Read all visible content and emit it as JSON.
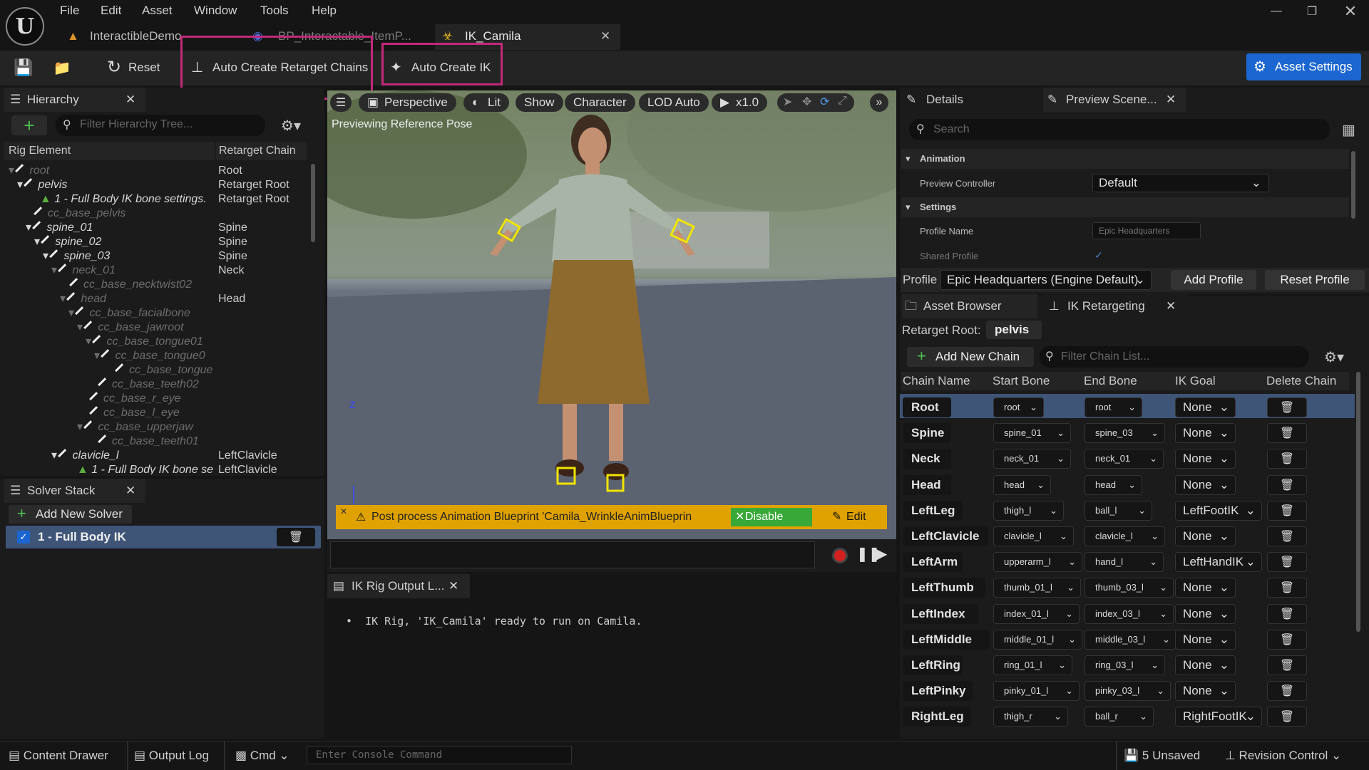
{
  "menu": [
    "File",
    "Edit",
    "Asset",
    "Window",
    "Tools",
    "Help"
  ],
  "tabs": [
    {
      "label": "InteractibleDemo"
    },
    {
      "label": "BP_Interactable_ItemP..."
    },
    {
      "label": "IK_Camila"
    }
  ],
  "toolbar": {
    "reset": "Reset",
    "auto_chains": "Auto Create Retarget Chains",
    "auto_ik": "Auto Create IK",
    "asset_settings": "Asset Settings"
  },
  "hierarchy": {
    "title": "Hierarchy",
    "filter_placeholder": "Filter Hierarchy Tree...",
    "col_element": "Rig Element",
    "col_chain": "Retarget Chain",
    "rows": [
      {
        "name": "root",
        "chain": "Root"
      },
      {
        "name": "pelvis",
        "chain": "Retarget Root"
      },
      {
        "name": "1 - Full Body IK bone settings.",
        "chain": "Retarget Root"
      },
      {
        "name": "cc_base_pelvis",
        "chain": ""
      },
      {
        "name": "spine_01",
        "chain": "Spine"
      },
      {
        "name": "spine_02",
        "chain": "Spine"
      },
      {
        "name": "spine_03",
        "chain": "Spine"
      },
      {
        "name": "neck_01",
        "chain": "Neck"
      },
      {
        "name": "cc_base_necktwist02",
        "chain": ""
      },
      {
        "name": "head",
        "chain": "Head"
      },
      {
        "name": "cc_base_facialbone",
        "chain": ""
      },
      {
        "name": "cc_base_jawroot",
        "chain": ""
      },
      {
        "name": "cc_base_tongue01",
        "chain": ""
      },
      {
        "name": "cc_base_tongue0",
        "chain": ""
      },
      {
        "name": "cc_base_tongue",
        "chain": ""
      },
      {
        "name": "cc_base_teeth02",
        "chain": ""
      },
      {
        "name": "cc_base_r_eye",
        "chain": ""
      },
      {
        "name": "cc_base_l_eye",
        "chain": ""
      },
      {
        "name": "cc_base_upperjaw",
        "chain": ""
      },
      {
        "name": "cc_base_teeth01",
        "chain": ""
      },
      {
        "name": "clavicle_l",
        "chain": "LeftClavicle"
      },
      {
        "name": "1 - Full Body IK bone se",
        "chain": "LeftClavicle"
      }
    ]
  },
  "solver": {
    "title": "Solver Stack",
    "add": "Add New Solver",
    "item": "1 - Full Body IK"
  },
  "viewport": {
    "perspective": "Perspective",
    "lit": "Lit",
    "show": "Show",
    "character": "Character",
    "lod": "LOD Auto",
    "speed": "x1.0",
    "preview_text": "Previewing Reference Pose",
    "warning": "Post process Animation Blueprint 'Camila_WrinkleAnimBlueprin",
    "disable": "Disable",
    "edit": "Edit",
    "axis_z": "Z"
  },
  "output": {
    "title": "IK Rig Output L...",
    "message": "IK Rig, 'IK_Camila' ready to run on Camila."
  },
  "details": {
    "title": "Details",
    "preview_tab": "Preview Scene...",
    "search_placeholder": "Search",
    "animation": "Animation",
    "preview_controller": "Preview Controller",
    "preview_controller_value": "Default",
    "settings": "Settings",
    "profile_name": "Profile Name",
    "profile_name_value": "Epic Headquarters",
    "shared_profile": "Shared Profile",
    "profile_label": "Profile",
    "profile_value": "Epic Headquarters (Engine Default)",
    "add_profile": "Add Profile",
    "reset_profile": "Reset Profile"
  },
  "retarget": {
    "asset_browser": "Asset Browser",
    "ik_retargeting": "IK Retargeting",
    "root_label": "Retarget Root:",
    "root_value": "pelvis",
    "add_chain": "Add New Chain",
    "filter_placeholder": "Filter Chain List...",
    "cols": [
      "Chain Name",
      "Start Bone",
      "End Bone",
      "IK Goal",
      "Delete Chain"
    ],
    "rows": [
      {
        "name": "Root",
        "start": "root",
        "end": "root",
        "goal": "None"
      },
      {
        "name": "Spine",
        "start": "spine_01",
        "end": "spine_03",
        "goal": "None"
      },
      {
        "name": "Neck",
        "start": "neck_01",
        "end": "neck_01",
        "goal": "None"
      },
      {
        "name": "Head",
        "start": "head",
        "end": "head",
        "goal": "None"
      },
      {
        "name": "LeftLeg",
        "start": "thigh_l",
        "end": "ball_l",
        "goal": "LeftFootIK"
      },
      {
        "name": "LeftClavicle",
        "start": "clavicle_l",
        "end": "clavicle_l",
        "goal": "None"
      },
      {
        "name": "LeftArm",
        "start": "upperarm_l",
        "end": "hand_l",
        "goal": "LeftHandIK"
      },
      {
        "name": "LeftThumb",
        "start": "thumb_01_l",
        "end": "thumb_03_l",
        "goal": "None"
      },
      {
        "name": "LeftIndex",
        "start": "index_01_l",
        "end": "index_03_l",
        "goal": "None"
      },
      {
        "name": "LeftMiddle",
        "start": "middle_01_l",
        "end": "middle_03_l",
        "goal": "None"
      },
      {
        "name": "LeftRing",
        "start": "ring_01_l",
        "end": "ring_03_l",
        "goal": "None"
      },
      {
        "name": "LeftPinky",
        "start": "pinky_01_l",
        "end": "pinky_03_l",
        "goal": "None"
      },
      {
        "name": "RightLeg",
        "start": "thigh_r",
        "end": "ball_r",
        "goal": "RightFootIK"
      }
    ]
  },
  "status": {
    "content_drawer": "Content Drawer",
    "output_log": "Output Log",
    "cmd": "Cmd",
    "console_placeholder": "Enter Console Command",
    "unsaved": "5 Unsaved",
    "revision": "Revision Control"
  }
}
